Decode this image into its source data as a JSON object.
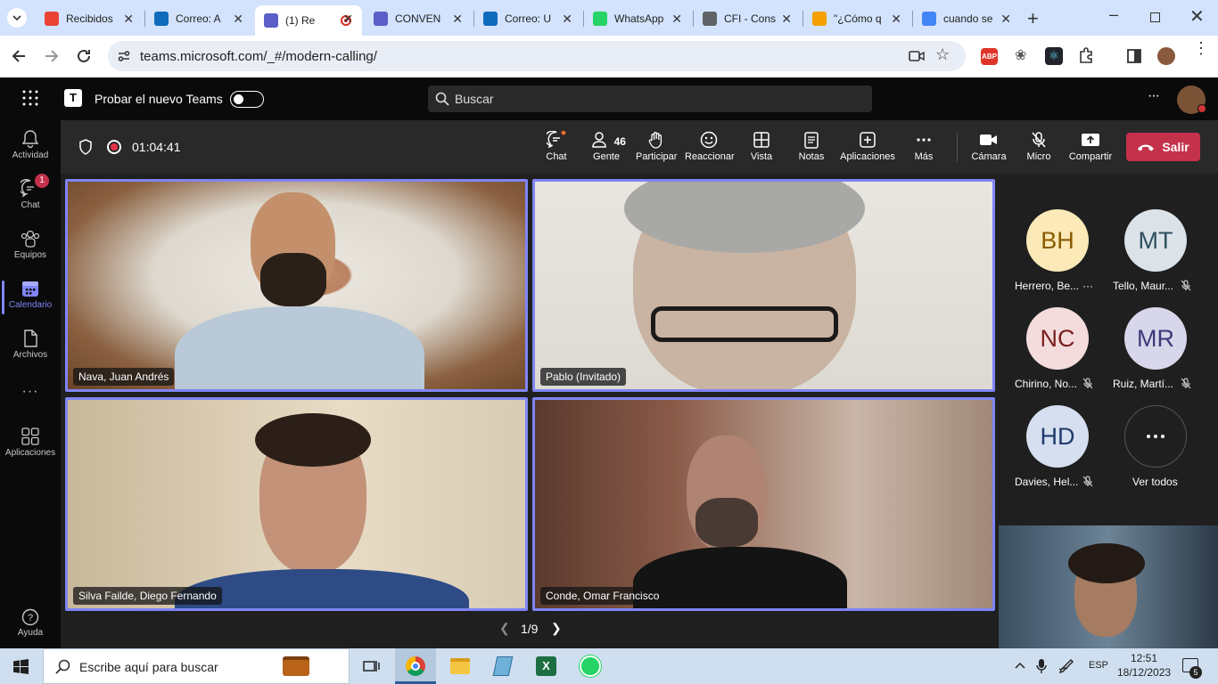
{
  "browser": {
    "tabs": [
      {
        "label": "Recibidos",
        "icon": "gmail-icon",
        "color": "#ea4335"
      },
      {
        "label": "Correo: A",
        "icon": "outlook-icon",
        "color": "#0f6cbd"
      },
      {
        "label": "(1) Re",
        "icon": "teams-icon",
        "color": "#5b5fc7",
        "active": true
      },
      {
        "label": "CONVEN",
        "icon": "teams-icon",
        "color": "#5b5fc7"
      },
      {
        "label": "Correo: U",
        "icon": "outlook-icon",
        "color": "#0f6cbd"
      },
      {
        "label": "WhatsApp",
        "icon": "whatsapp-icon",
        "color": "#25d366"
      },
      {
        "label": "CFI - Cons",
        "icon": "globe-icon",
        "color": "#5f6368"
      },
      {
        "label": "\"¿Cómo q",
        "icon": "site-icon",
        "color": "#f4a000"
      },
      {
        "label": "cuando se",
        "icon": "google-icon",
        "color": "#4285f4"
      }
    ],
    "url": "teams.microsoft.com/_#/modern-calling/"
  },
  "teams": {
    "try_new_label": "Probar el nuevo Teams",
    "search_placeholder": "Buscar",
    "more_label": "···"
  },
  "rail": {
    "items": [
      {
        "label": "Actividad",
        "icon": "bell-icon"
      },
      {
        "label": "Chat",
        "icon": "chat-icon",
        "badge": "1"
      },
      {
        "label": "Equipos",
        "icon": "teams-group-icon"
      },
      {
        "label": "Calendario",
        "icon": "calendar-icon",
        "active": true
      },
      {
        "label": "Archivos",
        "icon": "file-icon"
      },
      {
        "label": "···",
        "icon": "more-icon"
      },
      {
        "label": "Aplicaciones",
        "icon": "apps-icon"
      }
    ],
    "help_label": "Ayuda"
  },
  "meeting": {
    "timer": "01:04:41",
    "toolbar": {
      "chat": "Chat",
      "people": "Gente",
      "people_count": "46",
      "raise": "Participar",
      "react": "Reaccionar",
      "view": "Vista",
      "notes": "Notas",
      "apps": "Aplicaciones",
      "more": "Más",
      "camera": "Cámara",
      "mic": "Micro",
      "share": "Compartir",
      "leave": "Salir"
    },
    "tiles": [
      {
        "name": "Nava, Juan Andrés"
      },
      {
        "name": "Pablo (Invitado)"
      },
      {
        "name": "Silva Failde, Diego Fernando"
      },
      {
        "name": "Conde, Omar Francisco"
      }
    ],
    "pager": "1/9",
    "participants": [
      {
        "initials": "BH",
        "name": "Herrero, Be...",
        "bg": "#fbe9b7",
        "fg": "#8a5a00",
        "status": "more"
      },
      {
        "initials": "MT",
        "name": "Tello, Maur...",
        "bg": "#dce3e8",
        "fg": "#2f4f5f",
        "status": "muted"
      },
      {
        "initials": "NC",
        "name": "Chirino, No...",
        "bg": "#f4dcdc",
        "fg": "#7a1f1f",
        "status": "muted"
      },
      {
        "initials": "MR",
        "name": "Ruiz, Martí...",
        "bg": "#d8d6ea",
        "fg": "#3b3a78",
        "status": "muted"
      },
      {
        "initials": "HD",
        "name": "Davies, Hel...",
        "bg": "#d5dff0",
        "fg": "#203a6b",
        "status": "muted"
      }
    ],
    "see_all": "Ver todos"
  },
  "taskbar": {
    "search_placeholder": "Escribe aquí para buscar",
    "lang": "ESP",
    "time": "12:51",
    "date": "18/12/2023",
    "notif_count": "5"
  }
}
